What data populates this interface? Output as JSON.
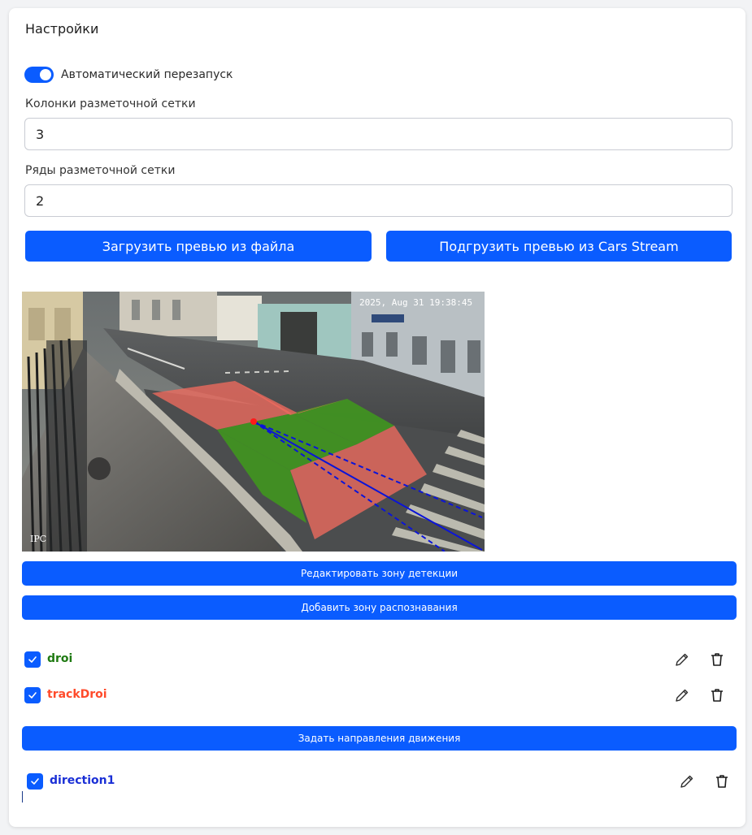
{
  "settings": {
    "title": "Настройки",
    "auto_restart_label": "Автоматический перезапуск",
    "auto_restart_enabled": true,
    "grid_columns_label": "Колонки разметочной сетки",
    "grid_columns_value": "3",
    "grid_rows_label": "Ряды разметочной сетки",
    "grid_rows_value": "2"
  },
  "actions": {
    "load_from_file": "Загрузить превью из файла",
    "load_from_stream": "Подгрузить превью из Cars Stream",
    "edit_detection_zone": "Редактировать зону детекции",
    "add_recognition_zone": "Добавить зону распознавания",
    "set_directions": "Задать направления движения"
  },
  "preview": {
    "timestamp": "2025, Aug 31 19:38:45",
    "camera_label": "IPC"
  },
  "zones": [
    {
      "label": "droi",
      "color": "#1f7a12",
      "checked": true
    },
    {
      "label": "trackDroi",
      "color": "#ff4a2a",
      "checked": true
    }
  ],
  "directions": [
    {
      "label": "direction1",
      "color": "#1a2fd6",
      "checked": true
    }
  ],
  "colors": {
    "accent": "#0a5cff",
    "zone_red": "#f06a5e",
    "zone_green": "#3f9a1c",
    "direction_line": "#0b14d8"
  },
  "icons": {
    "edit": "pencil-icon",
    "delete": "trash-icon",
    "check": "checkmark-icon"
  }
}
